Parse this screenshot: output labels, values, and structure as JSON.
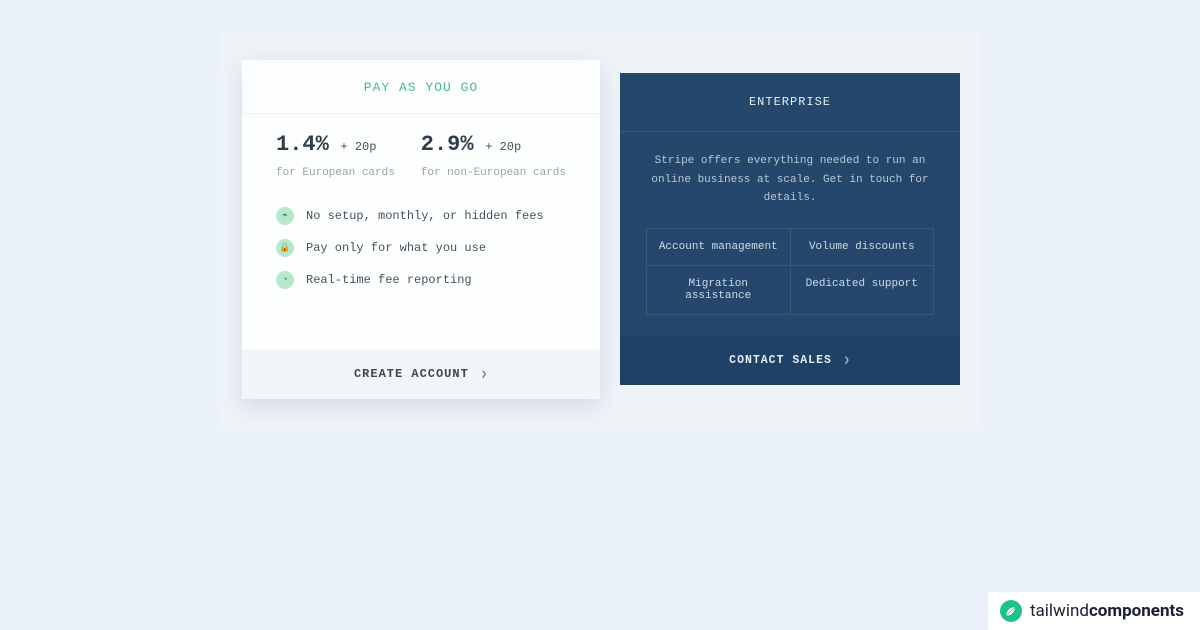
{
  "left": {
    "title": "PAY AS YOU GO",
    "price1": {
      "main": "1.4%",
      "addon": "+ 20p",
      "sub": "for European cards"
    },
    "price2": {
      "main": "2.9%",
      "addon": "+ 20p",
      "sub": "for non-European cards"
    },
    "features": [
      "No setup, monthly, or hidden fees",
      "Pay only for what you use",
      "Real-time fee reporting"
    ],
    "cta": "CREATE ACCOUNT"
  },
  "right": {
    "title": "ENTERPRISE",
    "description": "Stripe offers everything needed to run an online business at scale. Get in touch for details.",
    "grid": [
      [
        "Account management",
        "Volume discounts"
      ],
      [
        "Migration assistance",
        "Dedicated support"
      ]
    ],
    "cta": "CONTACT SALES"
  },
  "brand": {
    "word1": "tailwind",
    "word2": "components"
  }
}
